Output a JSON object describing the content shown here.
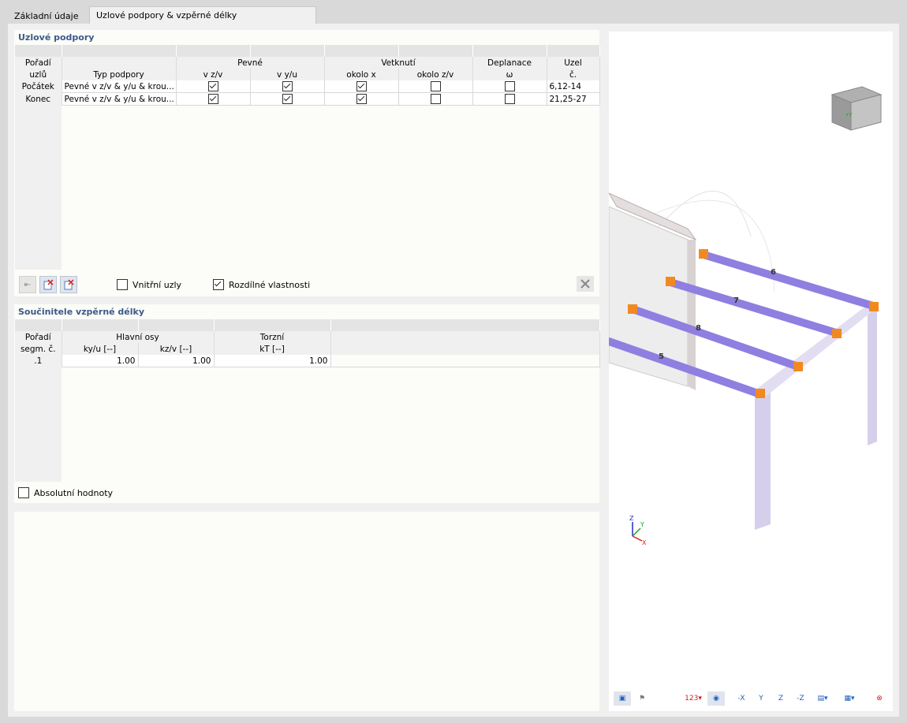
{
  "tabs": [
    {
      "label": "Základní údaje",
      "active": false
    },
    {
      "label": "Uzlové podpory & vzpěrné délky",
      "active": true
    }
  ],
  "nodal_supports": {
    "title": "Uzlové podpory",
    "headers": {
      "order": "Pořadí",
      "order2": "uzlů",
      "type": "Typ podpory",
      "fixed": "Pevné",
      "fixed_vz": "v z/v",
      "fixed_vy": "v y/u",
      "restraint": "Vetknutí",
      "rot_x": "okolo x",
      "rot_z": "okolo z/v",
      "warping": "Deplanace",
      "warping_sym": "ω",
      "node": "Uzel",
      "node2": "č."
    },
    "rows": [
      {
        "order": "Počátek",
        "type": "Pevné v z/v & y/u & krou...",
        "vz": true,
        "vy": true,
        "rx": true,
        "rz": false,
        "w": false,
        "node": "6,12-14"
      },
      {
        "order": "Konec",
        "type": "Pevné v z/v & y/u & krou...",
        "vz": true,
        "vy": true,
        "rx": true,
        "rz": false,
        "w": false,
        "node": "21,25-27"
      }
    ],
    "inner_nodes_label": "Vnitřní uzly",
    "inner_nodes_checked": false,
    "diff_props_label": "Rozdílné vlastnosti",
    "diff_props_checked": true
  },
  "buckling": {
    "title": "Součinitele vzpěrné délky",
    "headers": {
      "order": "Pořadí",
      "order2": "segm. č.",
      "main_axes": "Hlavní osy",
      "ky": "ky/u [--]",
      "kz": "kz/v [--]",
      "torsion": "Torzní",
      "kt": "kT [--]"
    },
    "rows": [
      {
        "order": ".1",
        "ky": "1.00",
        "kz": "1.00",
        "kt": "1.00"
      }
    ],
    "absolute_label": "Absolutní hodnoty",
    "absolute_checked": false
  },
  "view": {
    "member_labels": [
      "6",
      "7",
      "8",
      "5"
    ],
    "axis_z": "Z",
    "axis_y": "Y",
    "axis_x": "X"
  },
  "colors": {
    "section_title": "#3b5a8a",
    "member": "#8f7fe0",
    "support": "#f08a20",
    "frame": "#cfc6e6"
  }
}
